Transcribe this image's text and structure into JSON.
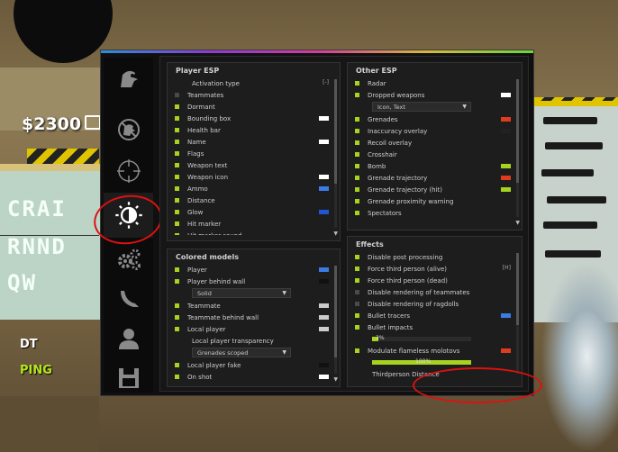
{
  "hud": {
    "money": "$2300",
    "dt": "DT",
    "ping": "PING"
  },
  "background": {
    "sign_lines": [
      "CRAI",
      "RNND",
      "QW"
    ]
  },
  "sidebar": {
    "tabs": [
      {
        "icon": "ragebot-icon",
        "active": false
      },
      {
        "icon": "anti-aim-icon",
        "active": false
      },
      {
        "icon": "crosshair-icon",
        "active": false
      },
      {
        "icon": "visuals-icon",
        "active": true
      },
      {
        "icon": "misc-gears-icon",
        "active": false
      },
      {
        "icon": "skins-knife-icon",
        "active": false
      },
      {
        "icon": "player-list-icon",
        "active": false
      },
      {
        "icon": "config-save-icon",
        "active": false
      }
    ]
  },
  "player_esp": {
    "title": "Player ESP",
    "activation_type": {
      "label": "Activation type",
      "hint": "[-]"
    },
    "items": [
      {
        "label": "Teammates",
        "on": false,
        "color": null
      },
      {
        "label": "Dormant",
        "on": true,
        "color": null
      },
      {
        "label": "Bounding box",
        "on": true,
        "color": "#ffffff"
      },
      {
        "label": "Health bar",
        "on": true,
        "color": null
      },
      {
        "label": "Name",
        "on": true,
        "color": "#ffffff"
      },
      {
        "label": "Flags",
        "on": true,
        "color": null
      },
      {
        "label": "Weapon text",
        "on": true,
        "color": null
      },
      {
        "label": "Weapon icon",
        "on": true,
        "color": "#ffffff"
      },
      {
        "label": "Ammo",
        "on": true,
        "color": "#3b7be6"
      },
      {
        "label": "Distance",
        "on": true,
        "color": null
      },
      {
        "label": "Glow",
        "on": true,
        "color": "#1f55d6"
      },
      {
        "label": "Hit marker",
        "on": true,
        "color": null
      },
      {
        "label": "Hit marker sound",
        "on": true,
        "color": null
      }
    ]
  },
  "colored_models": {
    "title": "Colored models",
    "items": [
      {
        "label": "Player",
        "on": true,
        "color": "#3b7be6"
      },
      {
        "label": "Player behind wall",
        "on": true,
        "color": "#111111"
      }
    ],
    "dropdown": "Solid",
    "items2": [
      {
        "label": "Teammate",
        "on": true,
        "color": "#cccccc"
      },
      {
        "label": "Teammate behind wall",
        "on": true,
        "color": "#cccccc"
      },
      {
        "label": "Local player",
        "on": true,
        "color": "#cccccc"
      }
    ],
    "transparency_label": "Local player transparency",
    "transparency_value": "Grenades scoped",
    "items3": [
      {
        "label": "Local player fake",
        "on": true,
        "color": "#111111"
      },
      {
        "label": "On shot",
        "on": true,
        "color": "#ffffff"
      }
    ]
  },
  "other_esp": {
    "title": "Other ESP",
    "items1": [
      {
        "label": "Radar",
        "on": true,
        "color": null
      },
      {
        "label": "Dropped weapons",
        "on": true,
        "color": "#ffffff"
      }
    ],
    "dropdown": "Icon, Text",
    "items2": [
      {
        "label": "Grenades",
        "on": true,
        "color": "#e23b1b"
      },
      {
        "label": "Inaccuracy overlay",
        "on": true,
        "color": "#222222"
      },
      {
        "label": "Recoil overlay",
        "on": true,
        "color": null
      },
      {
        "label": "Crosshair",
        "on": true,
        "color": null
      },
      {
        "label": "Bomb",
        "on": true,
        "color": "#a7d31f"
      },
      {
        "label": "Grenade trajectory",
        "on": true,
        "color": "#e23b1b"
      },
      {
        "label": "Grenade trajectory (hit)",
        "on": true,
        "color": "#a7d31f"
      },
      {
        "label": "Grenade proximity warning",
        "on": true,
        "color": null
      },
      {
        "label": "Spectators",
        "on": true,
        "color": null
      }
    ]
  },
  "effects": {
    "title": "Effects",
    "items": [
      {
        "label": "Disable post processing",
        "on": true,
        "color": null,
        "hint": null
      },
      {
        "label": "Force third person (alive)",
        "on": true,
        "color": null,
        "hint": "[H]"
      },
      {
        "label": "Force third person (dead)",
        "on": true,
        "color": null,
        "hint": null
      },
      {
        "label": "Disable rendering of teammates",
        "on": false,
        "color": null,
        "hint": null
      },
      {
        "label": "Disable rendering of ragdolls",
        "on": false,
        "color": null,
        "hint": null
      },
      {
        "label": "Bullet tracers",
        "on": true,
        "color": "#3b7be6",
        "hint": null
      },
      {
        "label": "Bullet impacts",
        "on": true,
        "color": null,
        "hint": null
      }
    ],
    "slider1": {
      "value": "3%",
      "fraction": 0.06
    },
    "modulate": {
      "label": "Modulate flameless molotovs",
      "on": true,
      "color": "#e23b1b"
    },
    "slider2": {
      "value": "100%",
      "fraction": 1.0
    },
    "thirdperson": {
      "label": "Thirdperson Distance",
      "value": "85",
      "fraction": 0.42
    }
  },
  "colors": {
    "accent": "#a7d31f",
    "panel": "#1d1d1d",
    "menu_bg": "#101010"
  }
}
